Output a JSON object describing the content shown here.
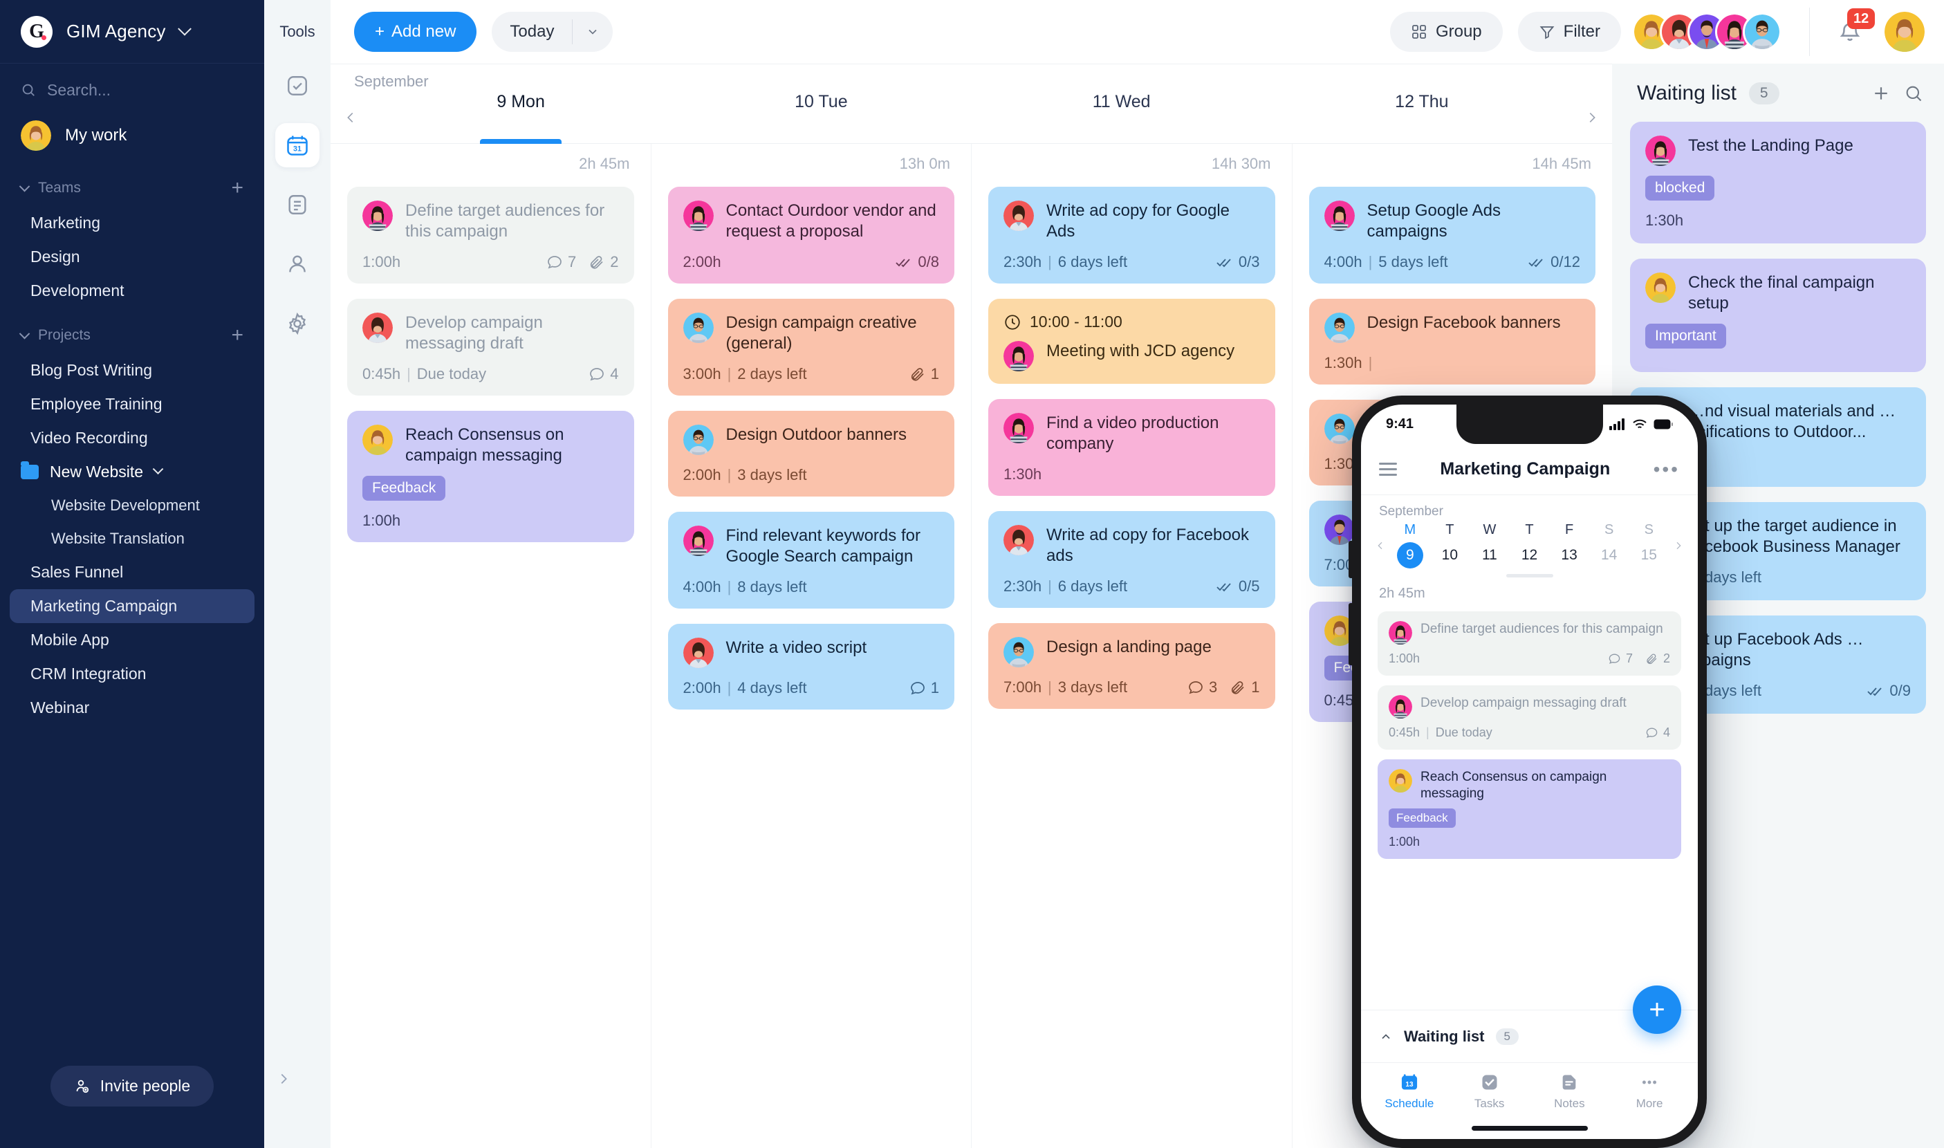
{
  "brand": {
    "name": "GIM Agency",
    "logo_letter": "G"
  },
  "sidebar": {
    "search_placeholder": "Search...",
    "my_work": "My work",
    "teams_label": "Teams",
    "teams": [
      "Marketing",
      "Design",
      "Development"
    ],
    "projects_label": "Projects",
    "projects": [
      {
        "label": "Blog Post Writing",
        "type": "item"
      },
      {
        "label": "Employee Training",
        "type": "item"
      },
      {
        "label": "Video Recording",
        "type": "item"
      },
      {
        "label": "New Website",
        "type": "folder"
      },
      {
        "label": "Website Development",
        "type": "sub"
      },
      {
        "label": "Website Translation",
        "type": "sub"
      },
      {
        "label": "Sales Funnel",
        "type": "item"
      },
      {
        "label": "Marketing Campaign",
        "type": "item",
        "active": true
      },
      {
        "label": "Mobile App",
        "type": "item"
      },
      {
        "label": "CRM Integration",
        "type": "item"
      },
      {
        "label": "Webinar",
        "type": "item"
      }
    ],
    "invite_label": "Invite people"
  },
  "tools": {
    "title": "Tools",
    "items": [
      {
        "icon": "checkbox-icon",
        "active": false
      },
      {
        "icon": "calendar-icon",
        "active": true,
        "day": "31"
      },
      {
        "icon": "notes-icon",
        "active": false
      },
      {
        "icon": "person-icon",
        "active": false
      },
      {
        "icon": "gear-icon",
        "active": false
      }
    ]
  },
  "toolbar": {
    "add_new": "Add new",
    "today": "Today",
    "group": "Group",
    "filter": "Filter",
    "notification_count": "12"
  },
  "calendar": {
    "month": "September",
    "days": [
      {
        "label": "9 Mon",
        "total": "2h 45m",
        "active": true
      },
      {
        "label": "10 Tue",
        "total": "13h 0m",
        "active": false
      },
      {
        "label": "11 Wed",
        "total": "14h 30m",
        "active": false
      },
      {
        "label": "12 Thu",
        "total": "14h 45m",
        "active": false
      }
    ],
    "columns": [
      {
        "day": "9 Mon",
        "cards": [
          {
            "title": "Define target audiences for this campaign",
            "duration": "1:00h",
            "due": "",
            "comments": "7",
            "attachments": "2",
            "subtasks": "",
            "color": "c-grey",
            "avatar": "pink-woman"
          },
          {
            "title": "Develop campaign messaging draft",
            "duration": "0:45h",
            "due": "Due today",
            "comments": "4",
            "attachments": "",
            "subtasks": "",
            "color": "c-grey",
            "avatar": "red-woman"
          },
          {
            "title": "Reach Consensus on campaign messaging",
            "duration": "1:00h",
            "due": "",
            "tag": "Feedback",
            "comments": "",
            "attachments": "",
            "subtasks": "",
            "color": "c-purple",
            "avatar": "yellow-woman"
          }
        ]
      },
      {
        "day": "10 Tue",
        "cards": [
          {
            "title": "Contact Ourdoor vendor and request a proposal",
            "duration": "2:00h",
            "due": "",
            "subtasks": "0/8",
            "comments": "",
            "attachments": "",
            "color": "c-pink",
            "avatar": "pink-woman"
          },
          {
            "title": "Design campaign creative (general)",
            "duration": "3:00h",
            "due": "2 days left",
            "attachments": "1",
            "comments": "",
            "subtasks": "",
            "color": "c-peach",
            "avatar": "blue-man"
          },
          {
            "title": "Design Outdoor banners",
            "duration": "2:00h",
            "due": "3 days left",
            "comments": "",
            "attachments": "",
            "subtasks": "",
            "color": "c-peach",
            "avatar": "blue-man"
          },
          {
            "title": "Find relevant keywords for Google Search campaign",
            "duration": "4:00h",
            "due": "8 days left",
            "comments": "",
            "attachments": "",
            "subtasks": "",
            "color": "c-blue",
            "avatar": "pink-woman"
          },
          {
            "title": "Write a video script",
            "duration": "2:00h",
            "due": "4 days left",
            "comments": "1",
            "attachments": "",
            "subtasks": "",
            "color": "c-blue",
            "avatar": "red-woman"
          }
        ]
      },
      {
        "day": "11 Wed",
        "cards": [
          {
            "title": "Write ad copy for Google Ads",
            "duration": "2:30h",
            "due": "6 days left",
            "subtasks": "0/3",
            "comments": "",
            "attachments": "",
            "color": "c-blue",
            "avatar": "red-woman"
          },
          {
            "title": "Meeting with JCD agency",
            "time": "10:00 - 11:00",
            "duration": "",
            "due": "",
            "comments": "",
            "attachments": "",
            "subtasks": "",
            "color": "c-amber",
            "avatar": "pink-woman"
          },
          {
            "title": "Find a video production company",
            "duration": "1:30h",
            "due": "",
            "comments": "",
            "attachments": "",
            "subtasks": "",
            "color": "c-pink2",
            "avatar": "pink-woman"
          },
          {
            "title": "Write ad copy for Facebook ads",
            "duration": "2:30h",
            "due": "6 days left",
            "subtasks": "0/5",
            "comments": "",
            "attachments": "",
            "color": "c-blue",
            "avatar": "red-woman"
          },
          {
            "title": "Design a landing page",
            "duration": "7:00h",
            "due": "3 days left",
            "comments": "3",
            "attachments": "1",
            "subtasks": "",
            "color": "c-peach",
            "avatar": "blue-man"
          }
        ]
      },
      {
        "day": "12 Thu",
        "cards": [
          {
            "title": "Setup Google Ads campaigns",
            "duration": "4:00h",
            "due": "5 days left",
            "subtasks": "0/12",
            "comments": "",
            "attachments": "",
            "color": "c-blue",
            "avatar": "pink-woman"
          },
          {
            "title": "Design Facebook banners",
            "duration": "1:30h",
            "due": "",
            "comments": "",
            "attachments": "",
            "subtasks": "",
            "color": "c-peach",
            "avatar": "blue-man"
          },
          {
            "title": "",
            "duration": "1:30h",
            "due": "",
            "comments": "",
            "attachments": "",
            "subtasks": "",
            "color": "c-peach",
            "avatar": "blue-man"
          },
          {
            "title": "",
            "duration": "7:00h",
            "due": "",
            "comments": "",
            "attachments": "",
            "subtasks": "",
            "color": "c-blue",
            "avatar": "purple-man"
          },
          {
            "title": "",
            "duration": "0:45h",
            "due": "",
            "tag": "Feedback",
            "comments": "",
            "attachments": "",
            "subtasks": "",
            "color": "c-purple",
            "avatar": "yellow-woman"
          }
        ]
      }
    ]
  },
  "waiting_list": {
    "title": "Waiting list",
    "count": "5",
    "cards": [
      {
        "title": "Test the Landing Page",
        "tag": "blocked",
        "duration": "1:30h",
        "color": "purple",
        "avatar": "pink-woman"
      },
      {
        "title": "Check the final campaign setup",
        "tag": "Important",
        "duration": "",
        "color": "purple",
        "avatar": "yellow-woman"
      },
      {
        "title": "…nd visual materials and …ecifications to Outdoor...",
        "tag": "",
        "duration": "",
        "color": "blue",
        "avatar": "blue-man"
      },
      {
        "title": "…t up the target audience in …cebook Business Manager",
        "due": "days left",
        "color": "blue",
        "avatar": "pink-woman"
      },
      {
        "title": "…t up Facebook Ads …mpaigns",
        "due": "days left",
        "subtasks": "0/9",
        "color": "blue",
        "avatar": "pink-woman"
      }
    ]
  },
  "phone": {
    "status_time": "9:41",
    "title": "Marketing Campaign",
    "month": "September",
    "week": [
      {
        "dow": "M",
        "num": "9",
        "selected": true
      },
      {
        "dow": "T",
        "num": "10"
      },
      {
        "dow": "W",
        "num": "11"
      },
      {
        "dow": "T",
        "num": "12"
      },
      {
        "dow": "F",
        "num": "13"
      },
      {
        "dow": "S",
        "num": "14",
        "weekend": true
      },
      {
        "dow": "S",
        "num": "15",
        "weekend": true
      }
    ],
    "day_total": "2h 45m",
    "cards": [
      {
        "title": "Define target audiences for this campaign",
        "duration": "1:00h",
        "due": "",
        "comments": "7",
        "attachments": "2",
        "color": "c-grey",
        "avatar": "pink-woman"
      },
      {
        "title": "Develop campaign messaging draft",
        "duration": "0:45h",
        "due": "Due today",
        "comments": "4",
        "attachments": "",
        "color": "c-grey",
        "avatar": "pink-woman"
      },
      {
        "title": "Reach Consensus on campaign messaging",
        "duration": "1:00h",
        "due": "",
        "tag": "Feedback",
        "color": "c-purple",
        "avatar": "yellow-woman"
      }
    ],
    "waiting_title": "Waiting list",
    "waiting_count": "5",
    "tabs": [
      {
        "label": "Schedule",
        "icon": "calendar-icon",
        "active": true,
        "day": "13"
      },
      {
        "label": "Tasks",
        "icon": "check-icon",
        "active": false
      },
      {
        "label": "Notes",
        "icon": "notes-icon",
        "active": false
      },
      {
        "label": "More",
        "icon": "dots-icon",
        "active": false
      }
    ]
  },
  "colors": {
    "accent": "#1b8df5",
    "sidebar_bg": "#112146",
    "sidebar_active": "#2c3f72",
    "badge_red": "#f04438",
    "card_grey": "#f0f3f2",
    "card_purple": "#cdcbf7",
    "card_pink": "#f5b8dd",
    "card_peach": "#fac2ab",
    "card_blue": "#b3ddfb",
    "card_amber": "#fcd9a6"
  }
}
